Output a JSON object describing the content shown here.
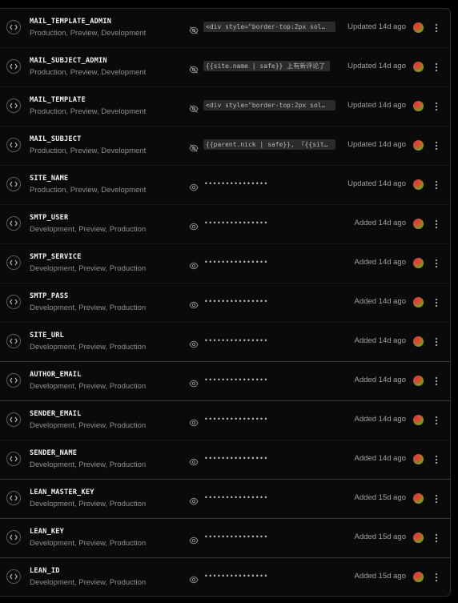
{
  "env_vars": [
    {
      "name": "MAIL_TEMPLATE_ADMIN",
      "targets": "Production, Preview, Development",
      "visible": false,
      "value": "<div style=\"border-top:2px sol…",
      "status": "Updated 14d ago"
    },
    {
      "name": "MAIL_SUBJECT_ADMIN",
      "targets": "Production, Preview, Development",
      "visible": false,
      "value": "{{site.name | safe}} 上有新评论了",
      "status": "Updated 14d ago"
    },
    {
      "name": "MAIL_TEMPLATE",
      "targets": "Production, Preview, Development",
      "visible": false,
      "value": "<div style=\"border-top:2px sol…",
      "status": "Updated 14d ago"
    },
    {
      "name": "MAIL_SUBJECT",
      "targets": "Production, Preview, Development",
      "visible": false,
      "value": "{{parent.nick | safe}}, 『{{sit…",
      "status": "Updated 14d ago"
    },
    {
      "name": "SITE_NAME",
      "targets": "Production, Preview, Development",
      "visible": true,
      "value": "•••••••••••••••",
      "status": "Updated 14d ago"
    },
    {
      "name": "SMTP_USER",
      "targets": "Development, Preview, Production",
      "visible": true,
      "value": "•••••••••••••••",
      "status": "Added 14d ago"
    },
    {
      "name": "SMTP_SERVICE",
      "targets": "Development, Preview, Production",
      "visible": true,
      "value": "•••••••••••••••",
      "status": "Added 14d ago"
    },
    {
      "name": "SMTP_PASS",
      "targets": "Development, Preview, Production",
      "visible": true,
      "value": "•••••••••••••••",
      "status": "Added 14d ago"
    },
    {
      "name": "SITE_URL",
      "targets": "Development, Preview, Production",
      "visible": true,
      "value": "•••••••••••••••",
      "status": "Added 14d ago"
    },
    {
      "name": "AUTHOR_EMAIL",
      "targets": "Development, Preview, Production",
      "visible": true,
      "value": "•••••••••••••••",
      "status": "Added 14d ago"
    },
    {
      "name": "SENDER_EMAIL",
      "targets": "Development, Preview, Production",
      "visible": true,
      "value": "•••••••••••••••",
      "status": "Added 14d ago"
    },
    {
      "name": "SENDER_NAME",
      "targets": "Development, Preview, Production",
      "visible": true,
      "value": "•••••••••••••••",
      "status": "Added 14d ago"
    },
    {
      "name": "LEAN_MASTER_KEY",
      "targets": "Development, Preview, Production",
      "visible": true,
      "value": "•••••••••••••••",
      "status": "Added 15d ago"
    },
    {
      "name": "LEAN_KEY",
      "targets": "Development, Preview, Production",
      "visible": true,
      "value": "•••••••••••••••",
      "status": "Added 15d ago"
    },
    {
      "name": "LEAN_ID",
      "targets": "Development, Preview, Production",
      "visible": true,
      "value": "•••••••••••••••",
      "status": "Added 15d ago"
    }
  ],
  "icons": {
    "type": "code-icon",
    "hidden": "eye-off-icon",
    "shown": "eye-icon",
    "menu": "more-vertical-icon",
    "avatar": "user-avatar"
  },
  "colors": {
    "background": "#000000",
    "row_text": "#f2f2f2",
    "muted": "#8f8f8f"
  }
}
